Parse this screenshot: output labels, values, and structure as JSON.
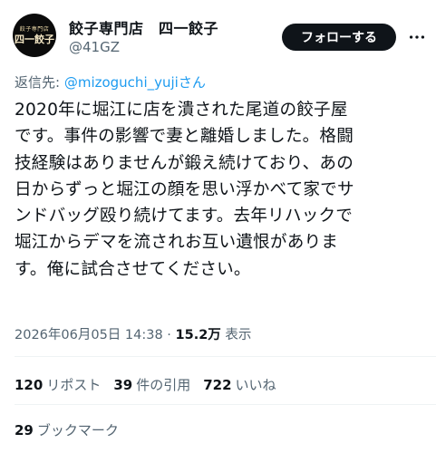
{
  "author": {
    "display_name": "餃子専門店　四一餃子",
    "handle": "@41GZ",
    "avatar_text_small": "餃子専門店",
    "avatar_text_big": "四一餃子"
  },
  "header": {
    "follow_label": "フォローする",
    "more_icon": "more-horizontal-icon"
  },
  "reply": {
    "prefix": "返信先: ",
    "mention": "@mizoguchi_yujiさん"
  },
  "tweet": {
    "lines": [
      "2020年に堀江に店を潰された尾道の餃子屋",
      "です。事件の影響で妻と離婚しました。格闘",
      "技経験はありませんが鍛え続けており、あの",
      "日からずっと堀江の顔を思い浮かべて家でサ",
      "ンドバッグ殴り続けてます。去年リハックで",
      "堀江からデマを流されお互い遺恨がありま",
      "す。俺に試合させてください。"
    ]
  },
  "meta": {
    "timestamp": "2026年06月05日 14:38",
    "separator": " · ",
    "views": "15.2万",
    "views_label": " 表示"
  },
  "stats": {
    "reposts": "120",
    "reposts_label": "リポスト",
    "quotes": "39",
    "quotes_label": "件の引用",
    "likes": "722",
    "likes_label": "いいね",
    "bookmarks": "29",
    "bookmarks_label": "ブックマーク"
  },
  "colors": {
    "text": "#0f1419",
    "secondary": "#536471",
    "link": "#1d9bf0",
    "divider": "#eff3f4"
  }
}
